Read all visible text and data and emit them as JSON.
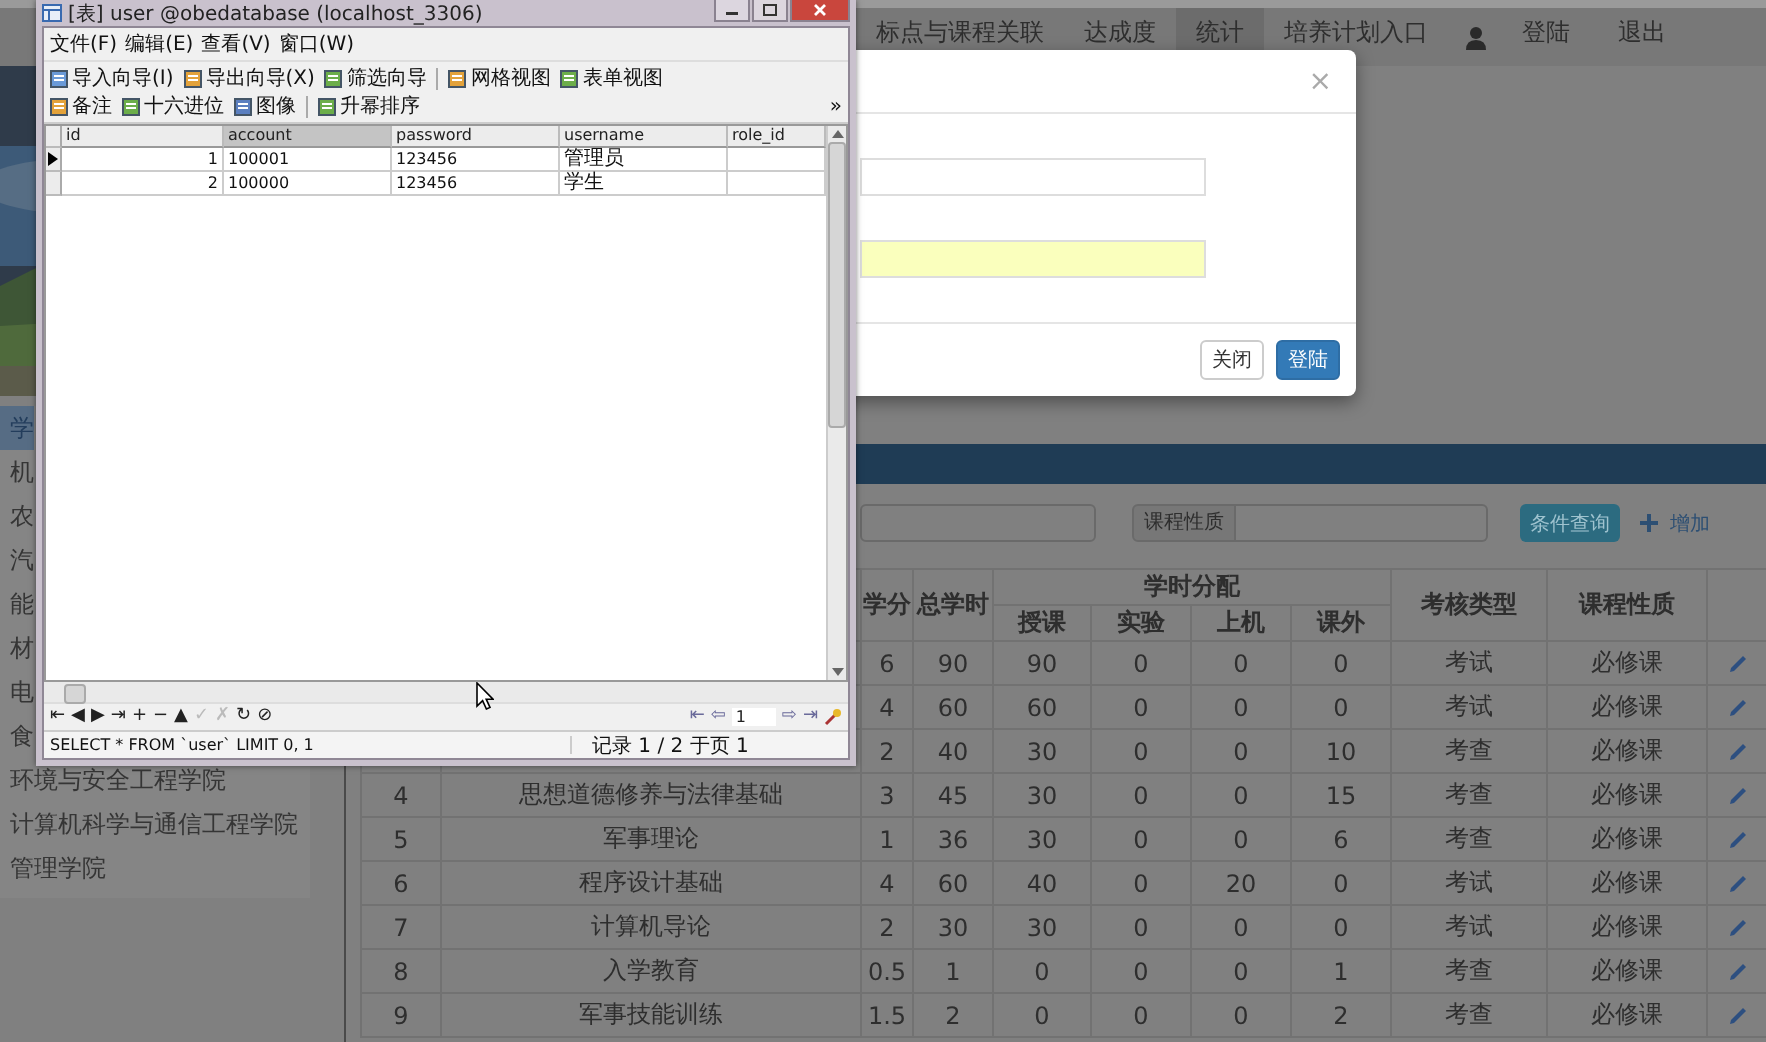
{
  "browser_page": {
    "nav": {
      "items": [
        {
          "label": "标点与课程关联",
          "selected": false
        },
        {
          "label": "达成度",
          "selected": false
        },
        {
          "label": "统计",
          "selected": true
        },
        {
          "label": "培养计划入口",
          "selected": false
        }
      ],
      "user_links": [
        "登陆",
        "退出"
      ]
    },
    "sidebar": {
      "items": [
        {
          "label": "学",
          "selected": true
        },
        {
          "label": "机",
          "selected": false
        },
        {
          "label": "农",
          "selected": false
        },
        {
          "label": "汽",
          "selected": false
        },
        {
          "label": "能",
          "selected": false
        },
        {
          "label": "材",
          "selected": false
        },
        {
          "label": "电",
          "selected": false
        },
        {
          "label": "食",
          "selected": false
        },
        {
          "label": "环境与安全工程学院",
          "selected": false
        },
        {
          "label": "计算机科学与通信工程学院",
          "selected": false
        },
        {
          "label": "管理学院",
          "selected": false
        }
      ]
    },
    "search": {
      "filter_label": "课程性质",
      "query_button": "条件查询",
      "add_link": "增加"
    },
    "table": {
      "columns": {
        "credits": "学分",
        "total_hours": "总学时",
        "group": "学时分配",
        "split": [
          "授课",
          "实验",
          "上机",
          "课外"
        ],
        "exam_type": "考核类型",
        "nature": "课程性质"
      },
      "rows": [
        {
          "credits": "6",
          "total": "90",
          "split": [
            "90",
            "0",
            "0",
            "0"
          ],
          "exam": "考试",
          "nature": "必修课"
        },
        {
          "credits": "4",
          "total": "60",
          "split": [
            "60",
            "0",
            "0",
            "0"
          ],
          "exam": "考试",
          "nature": "必修课"
        },
        {
          "credits": "2",
          "total": "40",
          "split": [
            "30",
            "0",
            "0",
            "10"
          ],
          "exam": "考查",
          "nature": "必修课"
        },
        {
          "no": "4",
          "name": "思想道德修养与法律基础",
          "credits": "3",
          "total": "45",
          "split": [
            "30",
            "0",
            "0",
            "15"
          ],
          "exam": "考查",
          "nature": "必修课"
        },
        {
          "no": "5",
          "name": "军事理论",
          "credits": "1",
          "total": "36",
          "split": [
            "30",
            "0",
            "0",
            "6"
          ],
          "exam": "考查",
          "nature": "必修课"
        },
        {
          "no": "6",
          "name": "程序设计基础",
          "credits": "4",
          "total": "60",
          "split": [
            "40",
            "0",
            "20",
            "0"
          ],
          "exam": "考试",
          "nature": "必修课"
        },
        {
          "no": "7",
          "name": "计算机导论",
          "credits": "2",
          "total": "30",
          "split": [
            "30",
            "0",
            "0",
            "0"
          ],
          "exam": "考试",
          "nature": "必修课"
        },
        {
          "no": "8",
          "name": "入学教育",
          "credits": "0.5",
          "total": "1",
          "split": [
            "0",
            "0",
            "0",
            "1"
          ],
          "exam": "考查",
          "nature": "必修课"
        },
        {
          "no": "9",
          "name": "军事技能训练",
          "credits": "1.5",
          "total": "2",
          "split": [
            "0",
            "0",
            "0",
            "2"
          ],
          "exam": "考查",
          "nature": "必修课"
        }
      ]
    }
  },
  "modal": {
    "close_glyph": "×",
    "fields": [
      {
        "autofilled": false
      },
      {
        "autofilled": true
      }
    ],
    "buttons": [
      {
        "label": "关闭",
        "kind": "default"
      },
      {
        "label": "登陆",
        "kind": "primary"
      }
    ]
  },
  "db_window": {
    "title": "[表] user @obedatabase (localhost_3306)",
    "menu": [
      "文件(F)",
      "编辑(E)",
      "查看(V)",
      "窗口(W)"
    ],
    "toolbar": [
      [
        [
          "导入向导(I)",
          "导出向导(X)",
          "筛选向导"
        ],
        [
          "网格视图",
          "表单视图"
        ]
      ],
      [
        [
          "备注",
          "十六进位",
          "图像"
        ],
        [
          "升幂排序"
        ]
      ]
    ],
    "overflow_glyph": "»",
    "grid": {
      "columns": [
        {
          "label": "id",
          "selected": false
        },
        {
          "label": "account",
          "selected": true
        },
        {
          "label": "password",
          "selected": false
        },
        {
          "label": "username",
          "selected": false
        },
        {
          "label": "role_id",
          "selected": false
        }
      ],
      "rows": [
        {
          "current": true,
          "cells": [
            "1",
            "100001",
            "123456",
            "管理员"
          ]
        },
        {
          "current": false,
          "cells": [
            "2",
            "100000",
            "123456",
            "学生"
          ]
        }
      ]
    },
    "record_nav": [
      {
        "glyph": "⇤",
        "disabled": false
      },
      {
        "glyph": "◀",
        "disabled": false
      },
      {
        "glyph": "▶",
        "disabled": false
      },
      {
        "glyph": "⇥",
        "disabled": false
      },
      {
        "glyph": "+",
        "disabled": false
      },
      {
        "glyph": "−",
        "disabled": false
      },
      {
        "glyph": "▲",
        "disabled": false
      },
      {
        "glyph": "✓",
        "disabled": true
      },
      {
        "glyph": "✗",
        "disabled": true
      },
      {
        "glyph": "↻",
        "disabled": false
      },
      {
        "glyph": "⊘",
        "disabled": false
      }
    ],
    "page_nav": {
      "prev": [
        "⇤",
        "⇦"
      ],
      "page": "1",
      "next": [
        "⇨",
        "⇥"
      ]
    },
    "status": {
      "sql": "SELECT * FROM `user` LIMIT 0, 1",
      "records": "记录 1 / 2 于页 1"
    }
  }
}
